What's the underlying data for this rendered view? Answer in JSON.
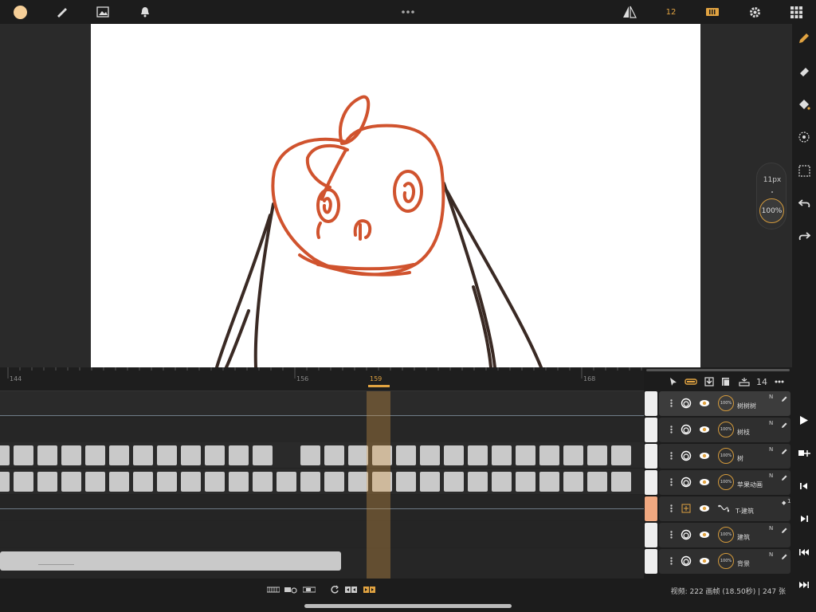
{
  "topbar": {
    "color_swatch": "#f6cf98",
    "icons": [
      "brush-icon",
      "image-icon",
      "bell-icon",
      "more-icon",
      "mirror-icon",
      "onion-skin-icon",
      "settings-icon",
      "grid-icon"
    ],
    "frame_number": "12"
  },
  "brush": {
    "size": "11px",
    "opacity": "100%"
  },
  "right_tools": [
    "pencil-icon",
    "eraser-icon",
    "fill-icon",
    "smudge-icon",
    "select-icon",
    "undo-icon",
    "redo-icon"
  ],
  "transport": [
    "play-icon",
    "add-frame-icon",
    "prev-frame-icon",
    "next-frame-icon",
    "first-frame-icon",
    "last-frame-icon"
  ],
  "timeline": {
    "ruler": [
      "144",
      "156",
      "159",
      "168"
    ],
    "current_frame": "159"
  },
  "layers_panel": {
    "count": "14",
    "layers": [
      {
        "name": "树树树",
        "blend": "N",
        "opacity": "100%",
        "selected": true
      },
      {
        "name": "树枝",
        "blend": "N",
        "opacity": "100%"
      },
      {
        "name": "树",
        "blend": "N",
        "opacity": "100%"
      },
      {
        "name": "苹果动画",
        "blend": "N",
        "opacity": "100%"
      },
      {
        "name": "T-建筑",
        "blend": "",
        "opacity": "",
        "group": true,
        "count": "1"
      },
      {
        "name": "建筑",
        "blend": "N",
        "opacity": "100%"
      },
      {
        "name": "背景",
        "blend": "N",
        "opacity": "100%"
      }
    ]
  },
  "status": {
    "text": "视频: 222 画帧 (18.50秒) | 247 张"
  },
  "colors": {
    "accent": "#e1a341",
    "stroke_red": "#d0532e",
    "stroke_dark": "#3a2a24"
  }
}
